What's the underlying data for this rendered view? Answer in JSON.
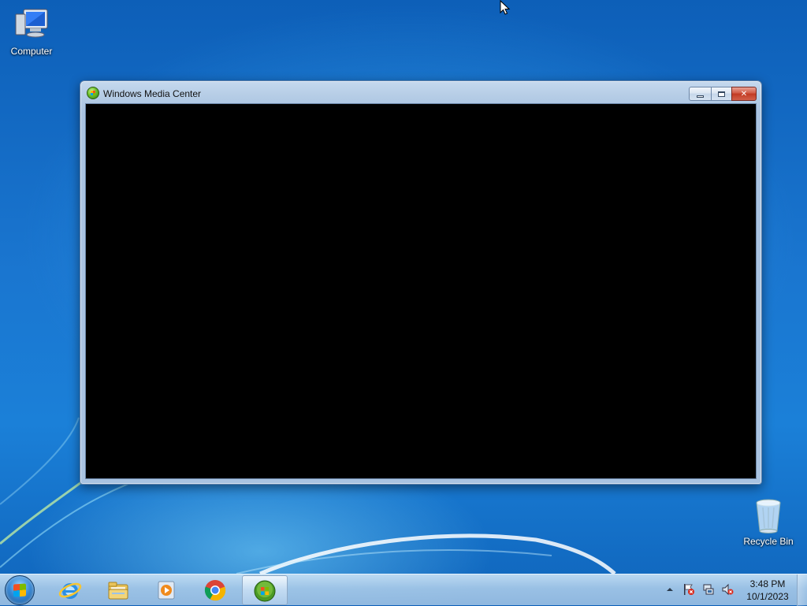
{
  "desktop": {
    "icons": [
      {
        "label": "Computer",
        "icon": "computer-icon"
      },
      {
        "label": "Recycle Bin",
        "icon": "recycle-bin-icon"
      }
    ]
  },
  "window": {
    "title": "Windows Media Center",
    "icon": "windows-media-center-icon",
    "buttons": {
      "minimize": "minimize-icon",
      "maximize": "maximize-icon",
      "close": "close-icon"
    }
  },
  "taskbar": {
    "start": "windows-logo-icon",
    "pinned": [
      {
        "name": "Internet Explorer",
        "icon": "internet-explorer-icon"
      },
      {
        "name": "Windows Explorer",
        "icon": "folder-icon"
      },
      {
        "name": "Windows Media Player",
        "icon": "media-player-icon"
      },
      {
        "name": "Google Chrome",
        "icon": "chrome-icon"
      },
      {
        "name": "Windows Media Center",
        "icon": "windows-media-center-icon",
        "active": true
      }
    ],
    "tray": {
      "icons": [
        "show-hidden-icons-arrow",
        "action-center-flag-icon",
        "network-icon",
        "volume-muted-icon"
      ],
      "time": "3:48 PM",
      "date": "10/1/2023"
    }
  },
  "colors": {
    "window_close": "#c23a22",
    "desktop_blue": "#1a76d0"
  }
}
